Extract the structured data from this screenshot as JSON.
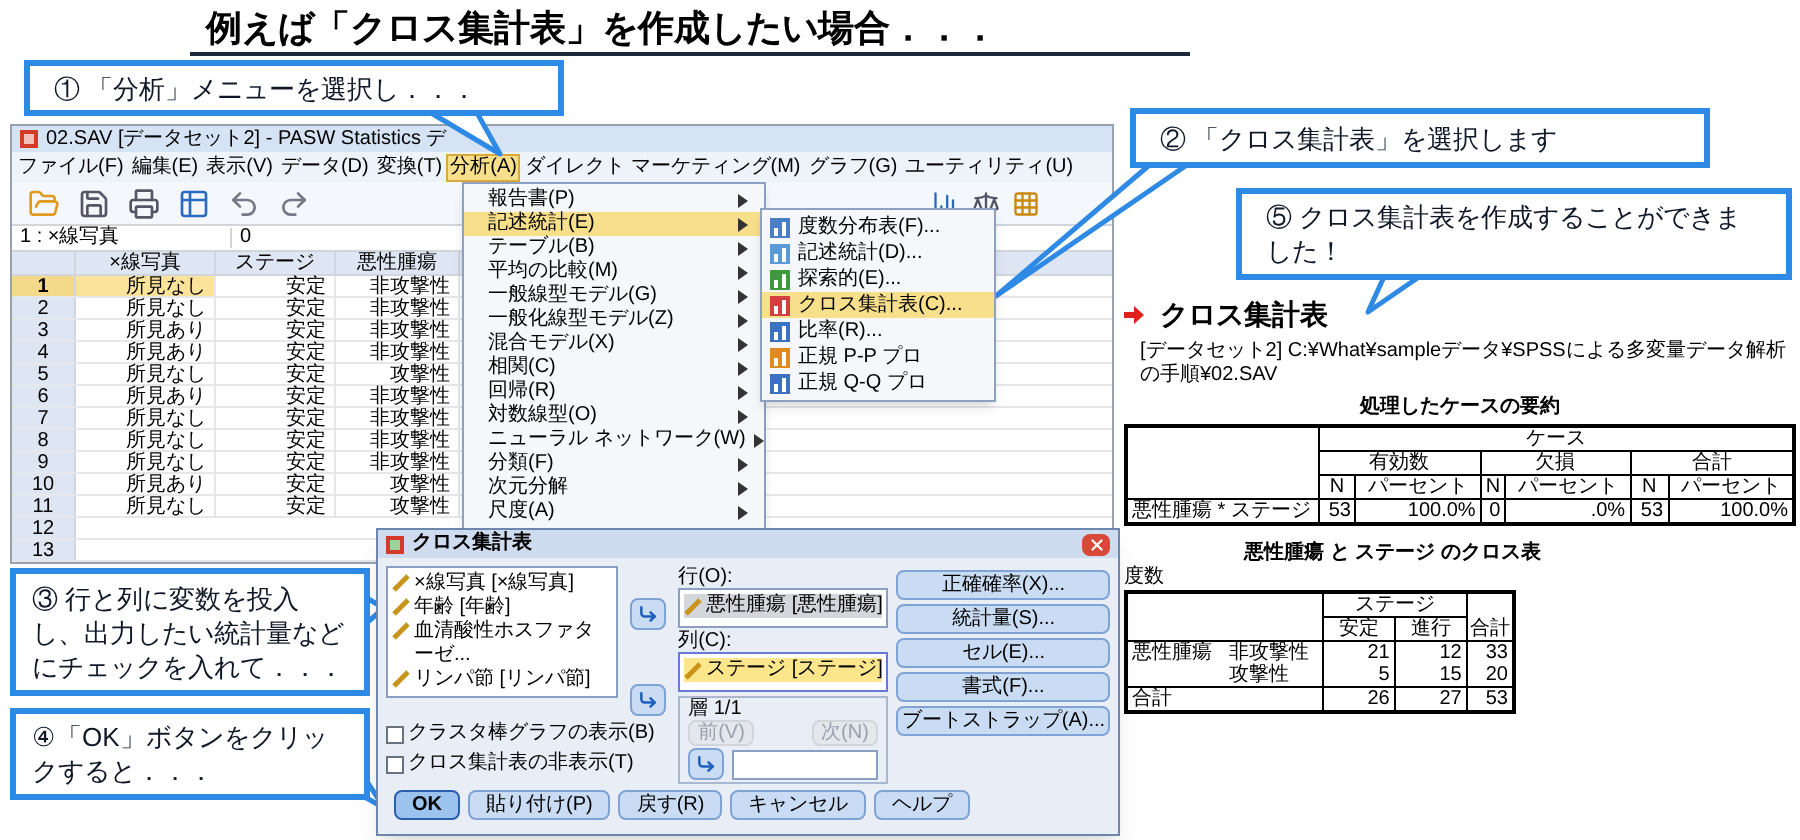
{
  "title": "例えば「クロス集計表」を作成したい場合．．．",
  "callouts": [
    "① 「分析」メニューを選択し．．．",
    "② 「クロス集計表」を選択します",
    "③ 行と列に変数を投入し、出力したい統計量などにチェックを入れて．．．",
    "④「OK」ボタンをクリックすると．．．",
    "⑤ クロス集計表を作成することができました！"
  ],
  "data_editor": {
    "title": "02.SAV [データセット2] - PASW Statistics デ",
    "menu_bar": [
      {
        "label": "ファイル(F)",
        "selected": false
      },
      {
        "label": "編集(E)",
        "selected": false
      },
      {
        "label": "表示(V)",
        "selected": false
      },
      {
        "label": "データ(D)",
        "selected": false
      },
      {
        "label": "変換(T)",
        "selected": false
      },
      {
        "label": "分析(A)",
        "selected": true
      },
      {
        "label": "ダイレクト マーケティング(M)",
        "selected": false
      },
      {
        "label": "グラフ(G)",
        "selected": false
      },
      {
        "label": "ユーティリティ(U)",
        "selected": false
      }
    ],
    "cell_name": "1 : ×線写真",
    "cell_value": "0",
    "columns": [
      "×線写真",
      "ステージ",
      "悪性腫瘍"
    ],
    "rows": [
      {
        "number": "1",
        "cells": [
          "所見なし",
          "安定",
          "非攻撃性"
        ],
        "selected": true
      },
      {
        "number": "2",
        "cells": [
          "所見なし",
          "安定",
          "非攻撃性"
        ],
        "selected": false
      },
      {
        "number": "3",
        "cells": [
          "所見あり",
          "安定",
          "非攻撃性"
        ],
        "selected": false
      },
      {
        "number": "4",
        "cells": [
          "所見あり",
          "安定",
          "非攻撃性"
        ],
        "selected": false
      },
      {
        "number": "5",
        "cells": [
          "所見なし",
          "安定",
          "攻撃性"
        ],
        "selected": false
      },
      {
        "number": "6",
        "cells": [
          "所見あり",
          "安定",
          "非攻撃性"
        ],
        "selected": false
      },
      {
        "number": "7",
        "cells": [
          "所見なし",
          "安定",
          "非攻撃性"
        ],
        "selected": false
      },
      {
        "number": "8",
        "cells": [
          "所見なし",
          "安定",
          "非攻撃性"
        ],
        "selected": false
      },
      {
        "number": "9",
        "cells": [
          "所見なし",
          "安定",
          "非攻撃性"
        ],
        "selected": false
      },
      {
        "number": "10",
        "cells": [
          "所見あり",
          "安定",
          "攻撃性"
        ],
        "selected": false
      },
      {
        "number": "11",
        "cells": [
          "所見なし",
          "安定",
          "攻撃性"
        ],
        "selected": false
      },
      {
        "number": "12",
        "selected": false
      },
      {
        "number": "13",
        "selected": false
      }
    ]
  },
  "analyze_menu": [
    {
      "label": "報告書(P)",
      "selected": false
    },
    {
      "label": "記述統計(E)",
      "selected": true
    },
    {
      "label": "テーブル(B)",
      "selected": false
    },
    {
      "label": "平均の比較(M)",
      "selected": false
    },
    {
      "label": "一般線型モデル(G)",
      "selected": false
    },
    {
      "label": "一般化線型モデル(Z)",
      "selected": false
    },
    {
      "label": "混合モデル(X)",
      "selected": false
    },
    {
      "label": "相関(C)",
      "selected": false
    },
    {
      "label": "回帰(R)",
      "selected": false
    },
    {
      "label": "対数線型(O)",
      "selected": false
    },
    {
      "label": "ニューラル ネットワーク(W)",
      "selected": false
    },
    {
      "label": "分類(F)",
      "selected": false
    },
    {
      "label": "次元分解",
      "selected": false
    },
    {
      "label": "尺度(A)",
      "selected": false
    }
  ],
  "submenu": [
    {
      "label": "度数分布表(F)...",
      "selected": false
    },
    {
      "label": "記述統計(D)...",
      "selected": false
    },
    {
      "label": "探索的(E)...",
      "selected": false
    },
    {
      "label": "クロス集計表(C)...",
      "selected": true
    },
    {
      "label": "比率(R)...",
      "selected": false
    },
    {
      "label": "正規 P-P プロ",
      "selected": false
    },
    {
      "label": "正規 Q-Q プロ",
      "selected": false
    }
  ],
  "dialog": {
    "title": "クロス集計表",
    "variables": [
      "×線写真 [×線写真]",
      "年齢 [年齢]",
      "血清酸性ホスファターゼ...",
      "リンパ節 [リンパ節]"
    ],
    "row_label": "行(O):",
    "row_variables": [
      "悪性腫瘍 [悪性腫瘍]"
    ],
    "column_label": "列(C):",
    "column_variables": [
      "ステージ [ステージ]"
    ],
    "layer_label": "層 1/1",
    "layer_buttons": [
      {
        "label": "前(V)",
        "disabled": true
      },
      {
        "label": "次(N)",
        "disabled": true
      }
    ],
    "side_buttons": [
      "正確確率(X)...",
      "統計量(S)...",
      "セル(E)...",
      "書式(F)...",
      "ブートストラップ(A)..."
    ],
    "checkboxes": [
      {
        "label": "クラスタ棒グラフの表示(B)",
        "checked": false
      },
      {
        "label": "クロス集計表の非表示(T)",
        "checked": false
      }
    ],
    "buttons": [
      {
        "label": "OK",
        "default": true
      },
      {
        "label": "貼り付け(P)",
        "default": false
      },
      {
        "label": "戻す(R)",
        "default": false
      },
      {
        "label": "キャンセル",
        "default": false
      },
      {
        "label": "ヘルプ",
        "default": false
      }
    ]
  },
  "output": {
    "heading": "クロス集計表",
    "path": "[データセット2] C:¥What¥sampleデータ¥SPSSによる多変量データ解析の手順¥02.SAV",
    "summary": {
      "title": "処理したケースの要約",
      "group_header": "ケース",
      "subheaders": [
        "有効数",
        "欠損",
        "合計"
      ],
      "stat_headers": [
        "N",
        "パーセント",
        "N",
        "パーセント",
        "N",
        "パーセント"
      ],
      "rows": [
        {
          "label": "悪性腫瘍 * ステージ",
          "values": [
            "53",
            "100.0%",
            "0",
            ".0%",
            "53",
            "100.0%"
          ]
        }
      ]
    },
    "crosstab": {
      "title": "悪性腫瘍 と ステージ のクロス表",
      "note": "度数",
      "column_group": "ステージ",
      "columns": [
        "安定",
        "進行"
      ],
      "total_header": "合計",
      "groups": [
        {
          "label": "悪性腫瘍",
          "rows": [
            {
              "label": "非攻撃性",
              "values": [
                "21",
                "12",
                "33"
              ]
            },
            {
              "label": "攻撃性",
              "values": [
                "5",
                "15",
                "20"
              ]
            }
          ]
        }
      ],
      "total": {
        "label": "合計",
        "values": [
          "26",
          "27",
          "53"
        ]
      }
    }
  }
}
